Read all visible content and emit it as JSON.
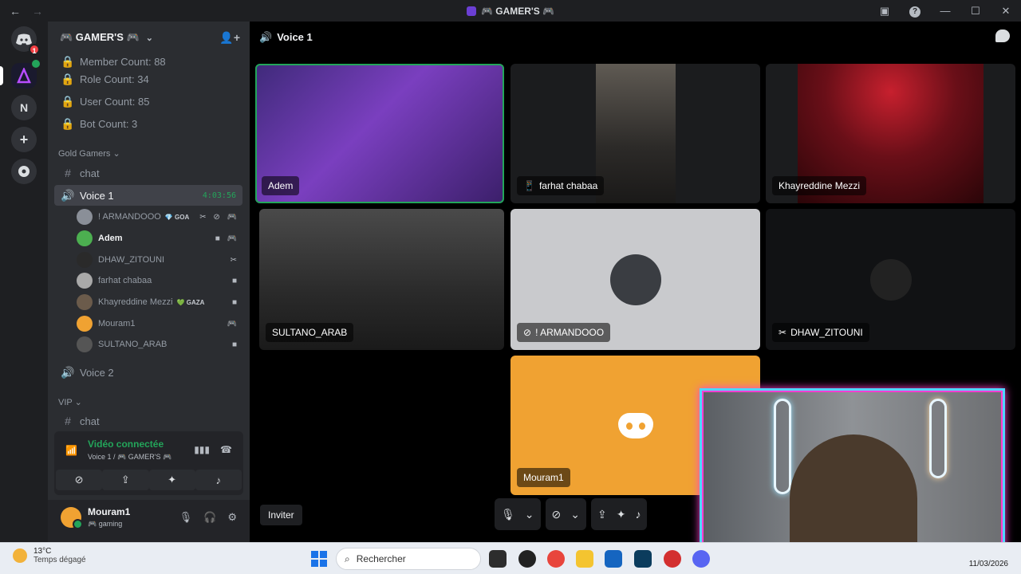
{
  "window": {
    "title": "🎮 GAMER'S 🎮",
    "back": "←",
    "forward": "→"
  },
  "rail": {
    "discord_badge": "1",
    "n_label": "N",
    "add_label": "+"
  },
  "server": {
    "name": "🎮 GAMER'S 🎮",
    "chevron": "⌄"
  },
  "channels": [
    {
      "label": "Member Count: 88",
      "icon": "lock-icon"
    },
    {
      "label": "Role Count: 34",
      "icon": "lock-icon"
    },
    {
      "label": "User Count: 85",
      "icon": "lock-icon"
    },
    {
      "label": "Bot Count: 3",
      "icon": "lock-icon"
    }
  ],
  "category_gold": "Gold Gamers ⌄",
  "chat_label": "chat",
  "voice1": {
    "label": "Voice 1",
    "timer": "4:03:56"
  },
  "voice_users": [
    {
      "name": "! ARMANDOOO",
      "tag": "💎 GOA",
      "icons": "✂ ⊘ 🎮",
      "color": "#8a8f98"
    },
    {
      "name": "Adem",
      "tag": "",
      "icons": "■ 🎮",
      "color": "#4caf50"
    },
    {
      "name": "DHAW_ZITOUNI",
      "tag": "",
      "icons": "✂",
      "color": "#2a2a2a"
    },
    {
      "name": "farhat chabaa",
      "tag": "",
      "icons": "■",
      "color": "#a9a9a9"
    },
    {
      "name": "Khayreddine Mezzi",
      "tag": "💚 GAZA",
      "icons": "■",
      "color": "#6b5b4b"
    },
    {
      "name": "Mouram1",
      "tag": "",
      "icons": "🎮",
      "color": "#f0a232"
    },
    {
      "name": "SULTANO_ARAB",
      "tag": "",
      "icons": "■",
      "color": "#555"
    }
  ],
  "voice2": "Voice 2",
  "category_vip": "VIP ⌄",
  "chat2_label": "chat",
  "voice_panel": {
    "status": "Vidéo connectée",
    "sub": "Voice 1 / 🎮 GAMER'S 🎮"
  },
  "user_panel": {
    "name": "Mouram1",
    "status": "🎮 gaming"
  },
  "main": {
    "title": "Voice 1",
    "inviter": "Inviter"
  },
  "tiles": {
    "adem": "Adem",
    "farhat": "farhat chabaa",
    "khay": "Khayreddine Mezzi",
    "sultano": "SULTANO_ARAB",
    "armando": "! ARMANDOOO",
    "dhaw": "DHAW_ZITOUNI",
    "mouram": "Mouram1"
  },
  "taskbar": {
    "temp": "13°C",
    "weather": "Temps dégagé",
    "search": "Rechercher",
    "date": "11/03/2026"
  },
  "colors": {
    "accent_green": "#23a55a",
    "speaking_border": "#23a55a",
    "mouram_tile": "#f0a232"
  }
}
